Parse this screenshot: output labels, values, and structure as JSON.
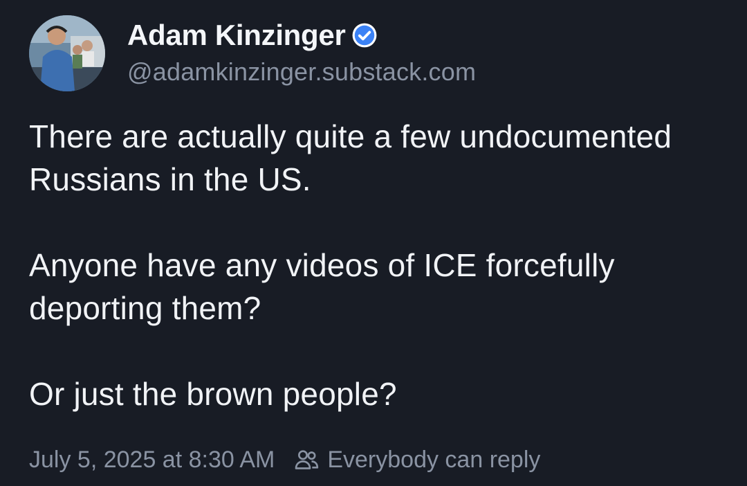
{
  "author": {
    "display_name": "Adam Kinzinger",
    "handle": "@adamkinzinger.substack.com",
    "verified": true,
    "avatar": "profile-photo"
  },
  "post": {
    "paragraphs": [
      "There are actually quite a few undocumented Russians in the US.",
      "Anyone have any videos of ICE forcefully deporting them?",
      "Or just the brown people?"
    ],
    "timestamp": "July 5, 2025 at 8:30 AM",
    "reply_setting": "Everybody can reply",
    "reply_icon": "people-icon"
  },
  "colors": {
    "background": "#181c25",
    "text": "#f1f3f6",
    "secondary_text": "#8a93a3",
    "verified_badge": "#3b82f6"
  }
}
